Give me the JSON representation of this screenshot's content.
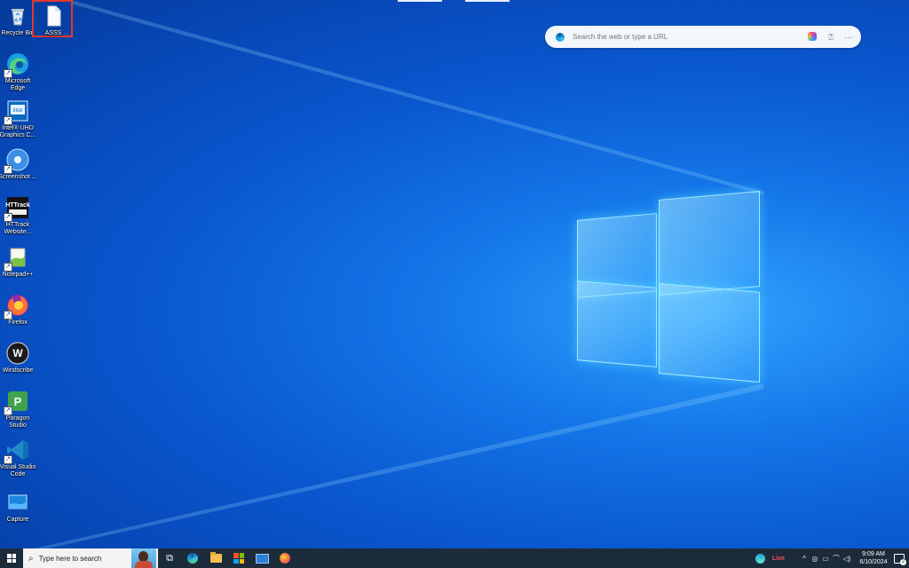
{
  "desktop": {
    "icons": [
      {
        "label": "Recycle Bin"
      },
      {
        "label": "ASSS"
      },
      {
        "label": "Microsoft Edge"
      },
      {
        "label": "Intel® UHD Graphics C..."
      },
      {
        "label": "Screenshot ..."
      },
      {
        "label": "HTTrack Website..."
      },
      {
        "label": "Notepad++"
      },
      {
        "label": "Firefox"
      },
      {
        "label": "Windscribe"
      },
      {
        "label": "Paragon Studio"
      },
      {
        "label": "Visual Studio Code"
      },
      {
        "label": "Capture"
      }
    ]
  },
  "search_widget": {
    "placeholder": "Search the web or type a URL",
    "icons": [
      "edge-icon",
      "copilot-icon",
      "help-icon",
      "more-icon"
    ]
  },
  "taskbar": {
    "search_placeholder": "Type here to search",
    "weather_label": "Live",
    "time": "9:09 AM",
    "date": "6/10/2024",
    "notification_count": "2",
    "colors": {
      "taskbar_bg": "#1c2b3a",
      "accent": "#0a58d0"
    }
  }
}
